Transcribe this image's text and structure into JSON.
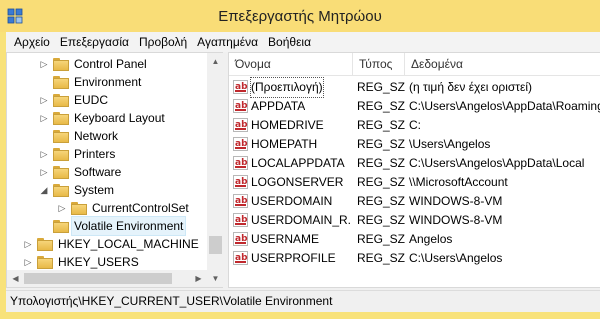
{
  "window": {
    "title": "Επεξεργαστής Μητρώου",
    "app_icon": "regedit-icon",
    "frame_color": "#f9dd77"
  },
  "menu": {
    "items": [
      "Αρχείο",
      "Επεξεργασία",
      "Προβολή",
      "Αγαπημένα",
      "Βοήθεια"
    ]
  },
  "tree": {
    "items": [
      {
        "label": "Control Panel",
        "expander": "▷"
      },
      {
        "label": "Environment",
        "expander": ""
      },
      {
        "label": "EUDC",
        "expander": "▷"
      },
      {
        "label": "Keyboard Layout",
        "expander": "▷"
      },
      {
        "label": "Network",
        "expander": ""
      },
      {
        "label": "Printers",
        "expander": "▷"
      },
      {
        "label": "Software",
        "expander": "▷"
      },
      {
        "label": "System",
        "expander": "◢"
      },
      {
        "label": "CurrentControlSet",
        "expander": "▷"
      },
      {
        "label": "Volatile Environment",
        "expander": ""
      },
      {
        "label": "HKEY_LOCAL_MACHINE",
        "expander": "▷"
      },
      {
        "label": "HKEY_USERS",
        "expander": "▷"
      }
    ],
    "selected_index": 9
  },
  "list": {
    "columns": [
      "Όνομα",
      "Τύπος",
      "Δεδομένα"
    ],
    "rows": [
      {
        "name": "(Προεπιλογή)",
        "type": "REG_SZ",
        "data": "(η τιμή δεν έχει οριστεί)"
      },
      {
        "name": "APPDATA",
        "type": "REG_SZ",
        "data": "C:\\Users\\Angelos\\AppData\\Roaming"
      },
      {
        "name": "HOMEDRIVE",
        "type": "REG_SZ",
        "data": "C:"
      },
      {
        "name": "HOMEPATH",
        "type": "REG_SZ",
        "data": "\\Users\\Angelos"
      },
      {
        "name": "LOCALAPPDATA",
        "type": "REG_SZ",
        "data": "C:\\Users\\Angelos\\AppData\\Local"
      },
      {
        "name": "LOGONSERVER",
        "type": "REG_SZ",
        "data": "\\\\MicrosoftAccount"
      },
      {
        "name": "USERDOMAIN",
        "type": "REG_SZ",
        "data": "WINDOWS-8-VM"
      },
      {
        "name": "USERDOMAIN_R...",
        "type": "REG_SZ",
        "data": "WINDOWS-8-VM"
      },
      {
        "name": "USERNAME",
        "type": "REG_SZ",
        "data": "Angelos"
      },
      {
        "name": "USERPROFILE",
        "type": "REG_SZ",
        "data": "C:\\Users\\Angelos"
      }
    ],
    "value_icon": "ab",
    "value_icon_color": "#c0282d"
  },
  "status": {
    "path": "Υπολογιστής\\HKEY_CURRENT_USER\\Volatile Environment"
  }
}
